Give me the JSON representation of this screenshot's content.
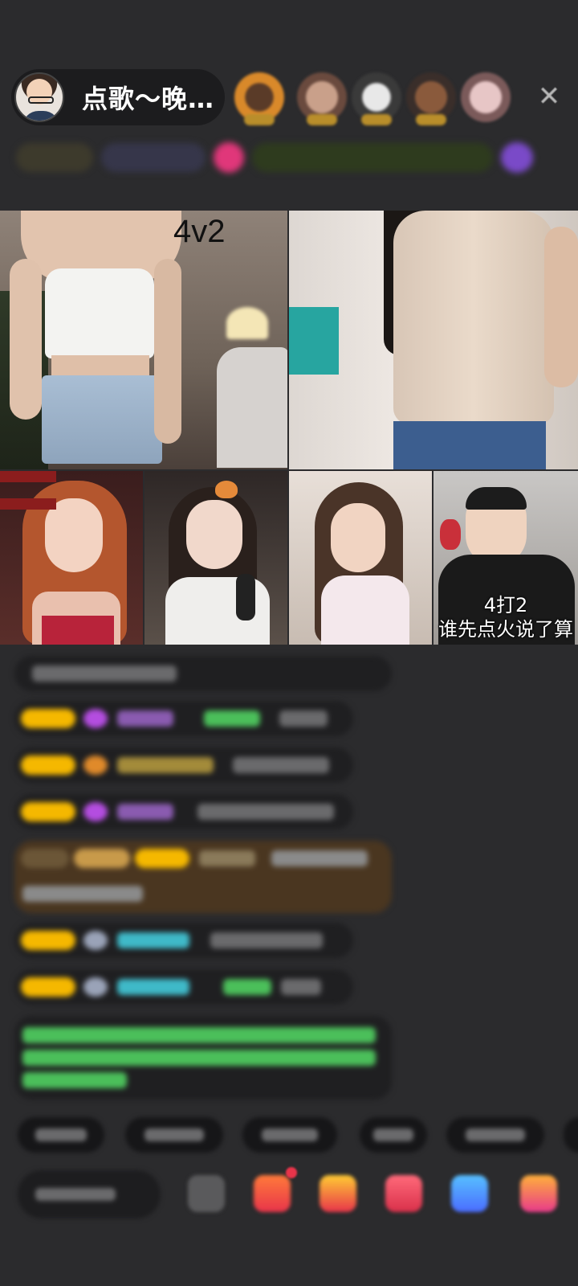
{
  "host": {
    "name": "点歌～晚…"
  },
  "stream": {
    "vs_label": "4v2",
    "caption_line1": "4打2",
    "caption_line2": "谁先点火说了算"
  },
  "colors": {
    "background": "#2b2b2d",
    "pill": "#1c1c1e",
    "accent_gold": "#f5b800",
    "accent_purple": "#b44de0",
    "accent_green": "#4bbf5a",
    "accent_cyan": "#3fb9c8"
  }
}
